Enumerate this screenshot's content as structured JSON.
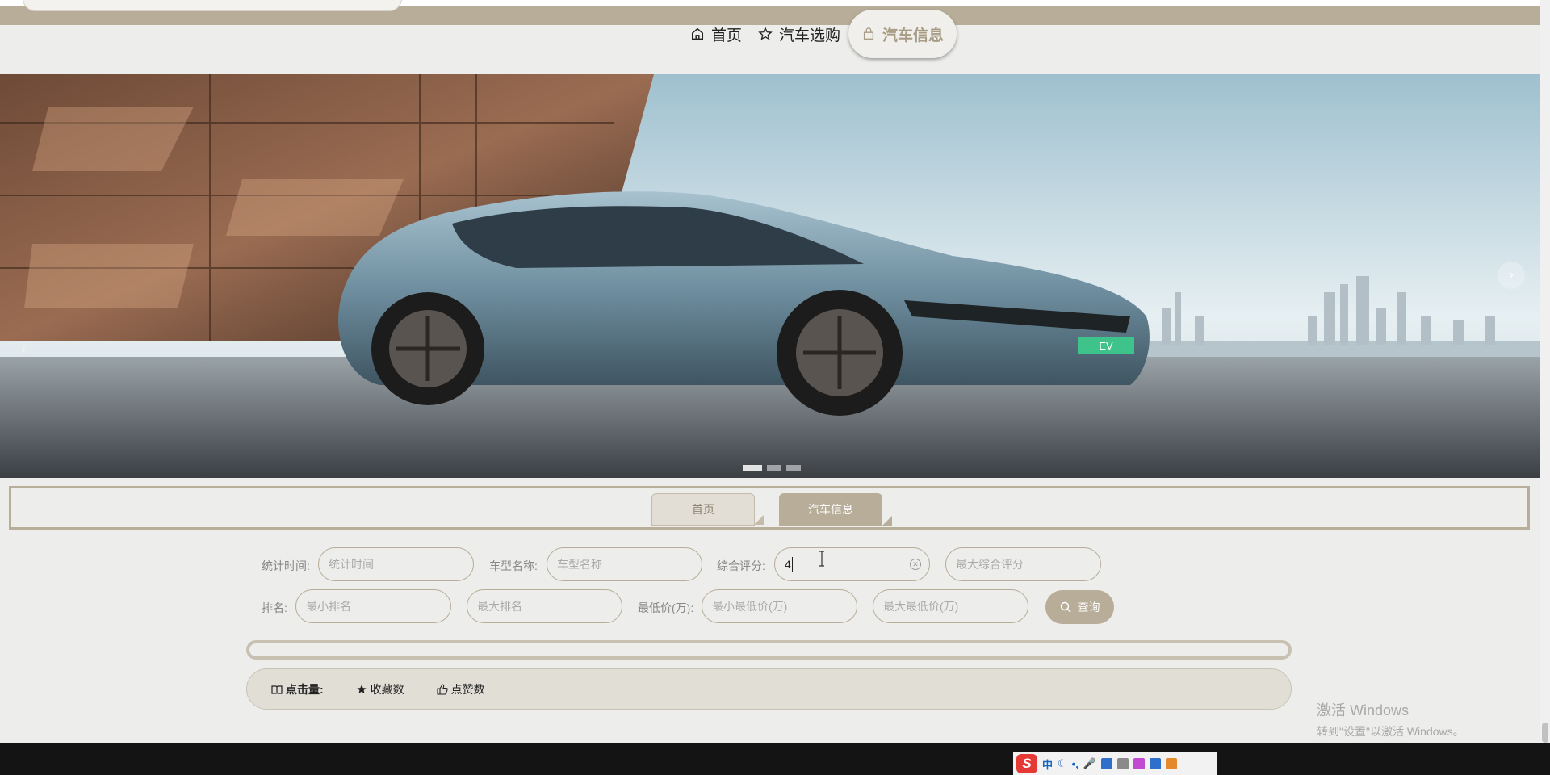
{
  "nav": {
    "home": "首页",
    "select": "汽车选购",
    "info": "汽车信息"
  },
  "banner": {
    "plate": "EV",
    "prev": "‹",
    "next": "›"
  },
  "breadcrumb": {
    "home": "首页",
    "current": "汽车信息"
  },
  "filters": {
    "stat_time_label": "统计时间:",
    "stat_time_placeholder": "统计时间",
    "model_label": "车型名称:",
    "model_placeholder": "车型名称",
    "score_label": "综合评分:",
    "score_value": "4",
    "score_max_placeholder": "最大综合评分",
    "rank_label": "排名:",
    "rank_min_placeholder": "最小排名",
    "rank_max_placeholder": "最大排名",
    "price_label": "最低价(万):",
    "price_min_placeholder": "最小最低价(万)",
    "price_max_placeholder": "最大最低价(万)",
    "query": "查询"
  },
  "sort": {
    "clicks": "点击量:",
    "favorites": "收藏数",
    "likes": "点赞数"
  },
  "watermark": {
    "line1": "激活 Windows",
    "line2": "转到\"设置\"以激活 Windows。"
  },
  "ime": {
    "logo": "S",
    "mode": "中"
  }
}
